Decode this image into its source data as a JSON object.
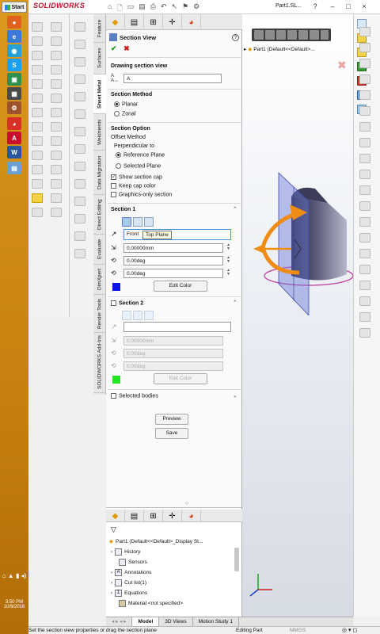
{
  "taskbar": {
    "start_label": "Start",
    "clock_time": "3:50 PM",
    "clock_date": "10/9/2016"
  },
  "app": {
    "brand": "SOLIDWORKS",
    "doc_title": "Part1.SL...",
    "help_symbol": "?",
    "minimize_symbol": "–",
    "restore_symbol": "□",
    "close_symbol": "×"
  },
  "vertical_tabs": [
    {
      "label": "Feature"
    },
    {
      "label": "Surfaces"
    },
    {
      "label": "Sheet Metal"
    },
    {
      "label": "Weldments"
    },
    {
      "label": "Data Migration"
    },
    {
      "label": "Direct Editing"
    },
    {
      "label": "Evaluate"
    },
    {
      "label": "DimXpert"
    },
    {
      "label": "Render Tools"
    },
    {
      "label": "SOLIDWORKS Add-Ins"
    }
  ],
  "property_manager": {
    "title": "Section View",
    "drawing_section_view": {
      "header": "Drawing section view",
      "name_value": "A"
    },
    "section_method": {
      "header": "Section Method",
      "options": [
        "Planar",
        "Zonal"
      ],
      "selected": "Planar"
    },
    "section_option": {
      "header": "Section Option",
      "offset_method_label": "Offset Method",
      "perpendicular_label": "Perpendicular to",
      "offset_options": [
        "Reference Plane",
        "Selected Plane"
      ],
      "show_section_cap": "Show section cap",
      "keep_cap_color": "Keep cap color",
      "graphics_only": "Graphics-only section"
    },
    "section1": {
      "header": "Section 1",
      "plane_value": "Front",
      "tooltip": "Top Plane",
      "distance": "0.00000mm",
      "angle1": "0.00deg",
      "angle2": "0.00deg",
      "edit_color_label": "Edit Color",
      "color": "#0a14e6"
    },
    "section2": {
      "header": "Section 2",
      "distance": "0.00000mm",
      "angle1": "0.00deg",
      "angle2": "0.00deg",
      "edit_color_label": "Edit Color",
      "color": "#22e622"
    },
    "selected_bodies_label": "Selected bodies",
    "preview_label": "Preview",
    "save_label": "Save"
  },
  "feature_tree": {
    "root": "Part1  (Default<<Default>_Display St...",
    "items": [
      {
        "label": "History"
      },
      {
        "label": "Sensors"
      },
      {
        "label": "Annotations"
      },
      {
        "label": "Cut list(1)"
      },
      {
        "label": "Equations"
      },
      {
        "label": "Material <not specified>"
      }
    ]
  },
  "viewport": {
    "breadcrumb": "Part1  (Default<<Default>..."
  },
  "bottom_tabs": [
    "Model",
    "3D Views",
    "Motion Study 1"
  ],
  "status_bar": {
    "message": "Set the section view properties or drag the section plane",
    "mode": "Editing Part",
    "units": "MMGS"
  },
  "colors": {
    "section_plane": "#6a78d8",
    "drag_arrow": "#f08c14",
    "cap_ring": "#c03c9c"
  }
}
